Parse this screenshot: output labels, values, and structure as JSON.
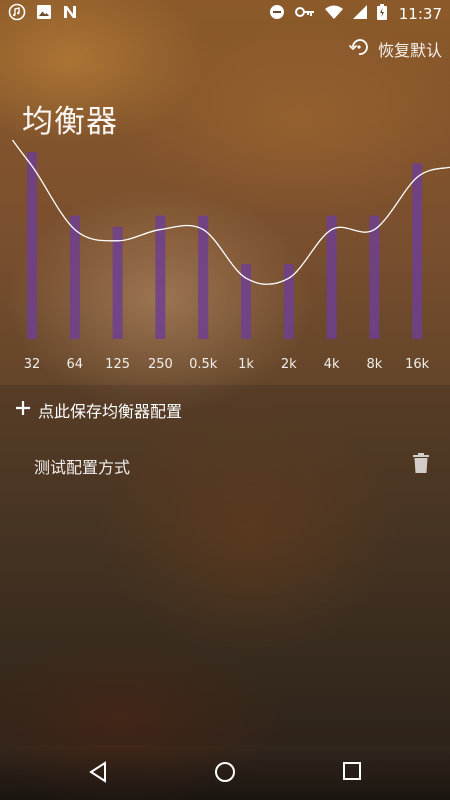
{
  "status_bar": {
    "time": "11:37",
    "left_icons": [
      "music-notification-icon",
      "image-notification-icon",
      "n-notification-icon"
    ],
    "right_icons": [
      "do-not-disturb-icon",
      "vpn-key-icon",
      "wifi-icon",
      "signal-icon",
      "battery-icon"
    ]
  },
  "header": {
    "restore_label": "恢复默认",
    "title": "均衡器"
  },
  "equalizer": {
    "bands": [
      "32",
      "64",
      "125",
      "250",
      "0.5k",
      "1k",
      "2k",
      "4k",
      "8k",
      "16k"
    ],
    "levels": [
      1.0,
      0.66,
      0.6,
      0.66,
      0.66,
      0.4,
      0.4,
      0.66,
      0.66,
      0.94
    ],
    "bar_color": "#6e3f8f",
    "curve_color": "#ffffff"
  },
  "presets": {
    "save_label": "点此保存均衡器配置",
    "items": [
      {
        "name": "测试配置方式"
      }
    ]
  },
  "nav_bar": {
    "buttons": [
      "back",
      "home",
      "recents"
    ]
  }
}
